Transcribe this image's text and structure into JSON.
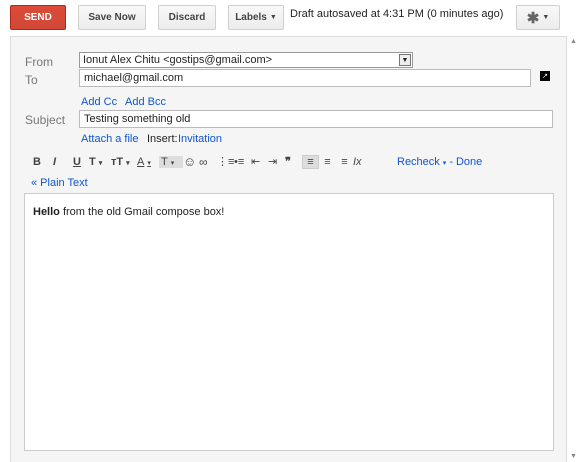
{
  "toolbar": {
    "send_label": "SEND",
    "save_label": "Save Now",
    "discard_label": "Discard",
    "labels_label": "Labels",
    "draft_status": "Draft autosaved at 4:31 PM (0 minutes ago)"
  },
  "compose": {
    "from_label": "From",
    "from_value": "Ionut Alex Chitu <gostips@gmail.com>",
    "to_label": "To",
    "to_value": "michael@gmail.com",
    "add_cc": "Add Cc",
    "add_bcc": "Add Bcc",
    "subject_label": "Subject",
    "subject_value": "Testing something old",
    "attach_file": "Attach a file",
    "insert_label": "Insert:",
    "invitation": "Invitation"
  },
  "formatting": {
    "bold": "B",
    "italic": "I",
    "underline": "U",
    "font": "T",
    "size": "тT",
    "text_color": "A",
    "highlight": "T",
    "recheck": "Recheck",
    "done": "Done",
    "plain_text": "« Plain Text"
  },
  "body": {
    "bold_text": "Hello",
    "rest_text": " from the old Gmail compose box!"
  },
  "colors": {
    "send_red": "#d14836",
    "link_blue": "#1155cc"
  },
  "icons": [
    "settings-gear-icon",
    "emoji-icon",
    "link-icon",
    "numbered-list-icon",
    "bulleted-list-icon",
    "indent-less-icon",
    "indent-more-icon",
    "quote-icon",
    "align-left-icon",
    "align-center-icon",
    "align-right-icon",
    "remove-formatting-icon",
    "popout-icon"
  ]
}
